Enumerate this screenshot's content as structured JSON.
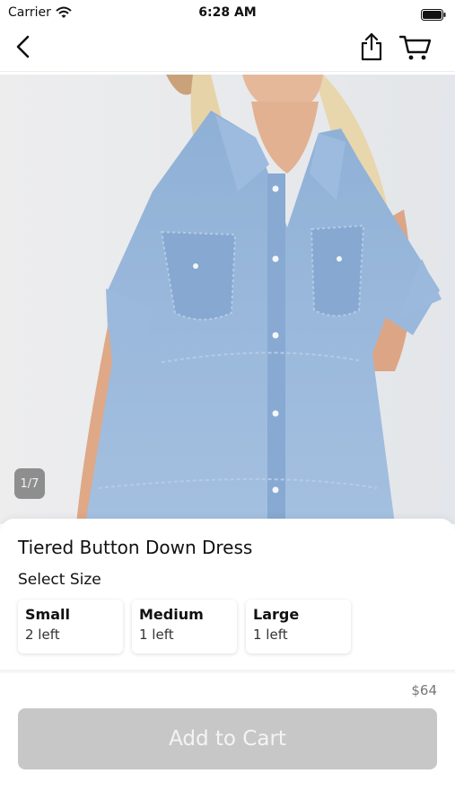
{
  "status_bar": {
    "carrier": "Carrier",
    "time": "6:28 AM",
    "icons": [
      "wifi-icon",
      "battery-icon"
    ]
  },
  "nav_bar": {
    "icons": [
      "chevron-left-icon",
      "share-icon",
      "cart-icon"
    ]
  },
  "gallery": {
    "counter": "1/7"
  },
  "product": {
    "title": "Tiered Button Down Dress",
    "select_size_label": "Select Size",
    "sizes": [
      {
        "name": "Small",
        "stock": "2 left"
      },
      {
        "name": "Medium",
        "stock": "1 left"
      },
      {
        "name": "Large",
        "stock": "1 left"
      }
    ],
    "price": "$64"
  },
  "actions": {
    "add_to_cart_label": "Add to Cart",
    "add_to_cart_state": "disabled"
  },
  "colors": {
    "button_disabled": "#c7c7c7",
    "denim": "#8fb0d6",
    "background": "#ffffff"
  }
}
